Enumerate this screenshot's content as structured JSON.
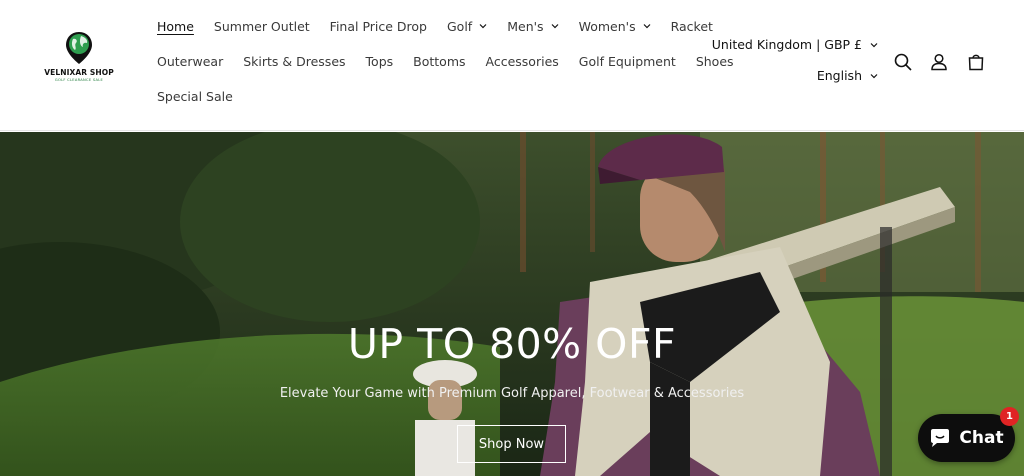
{
  "brand": {
    "name": "VELNIXAR SHOP",
    "tagline": "GOLF CLEARANCE SALE"
  },
  "nav": {
    "row1": [
      {
        "label": "Home",
        "active": true,
        "dropdown": false
      },
      {
        "label": "Summer Outlet",
        "dropdown": false
      },
      {
        "label": "Final Price Drop",
        "dropdown": false
      },
      {
        "label": "Golf",
        "dropdown": true
      },
      {
        "label": "Men's",
        "dropdown": true
      },
      {
        "label": "Women's",
        "dropdown": true
      },
      {
        "label": "Racket",
        "dropdown": false
      }
    ],
    "row2": [
      {
        "label": "Outerwear"
      },
      {
        "label": "Skirts & Dresses"
      },
      {
        "label": "Tops"
      },
      {
        "label": "Bottoms"
      },
      {
        "label": "Accessories"
      },
      {
        "label": "Golf Equipment"
      },
      {
        "label": "Shoes"
      }
    ],
    "row3": [
      {
        "label": "Special Sale"
      }
    ]
  },
  "locale": {
    "country": "United Kingdom | GBP £",
    "language": "English"
  },
  "header_icons": [
    "search-icon",
    "account-icon",
    "cart-icon"
  ],
  "hero": {
    "title": "UP TO 80% OFF",
    "subtitle": "Elevate Your Game with Premium Golf Apparel, Footwear & Accessories",
    "button": "Shop Now"
  },
  "chat": {
    "label": "Chat",
    "badge": "1"
  },
  "colors": {
    "text": "#121212",
    "brand_green": "#1f7a3a",
    "chat_bg": "#0d0d0d",
    "badge": "#e02424"
  }
}
